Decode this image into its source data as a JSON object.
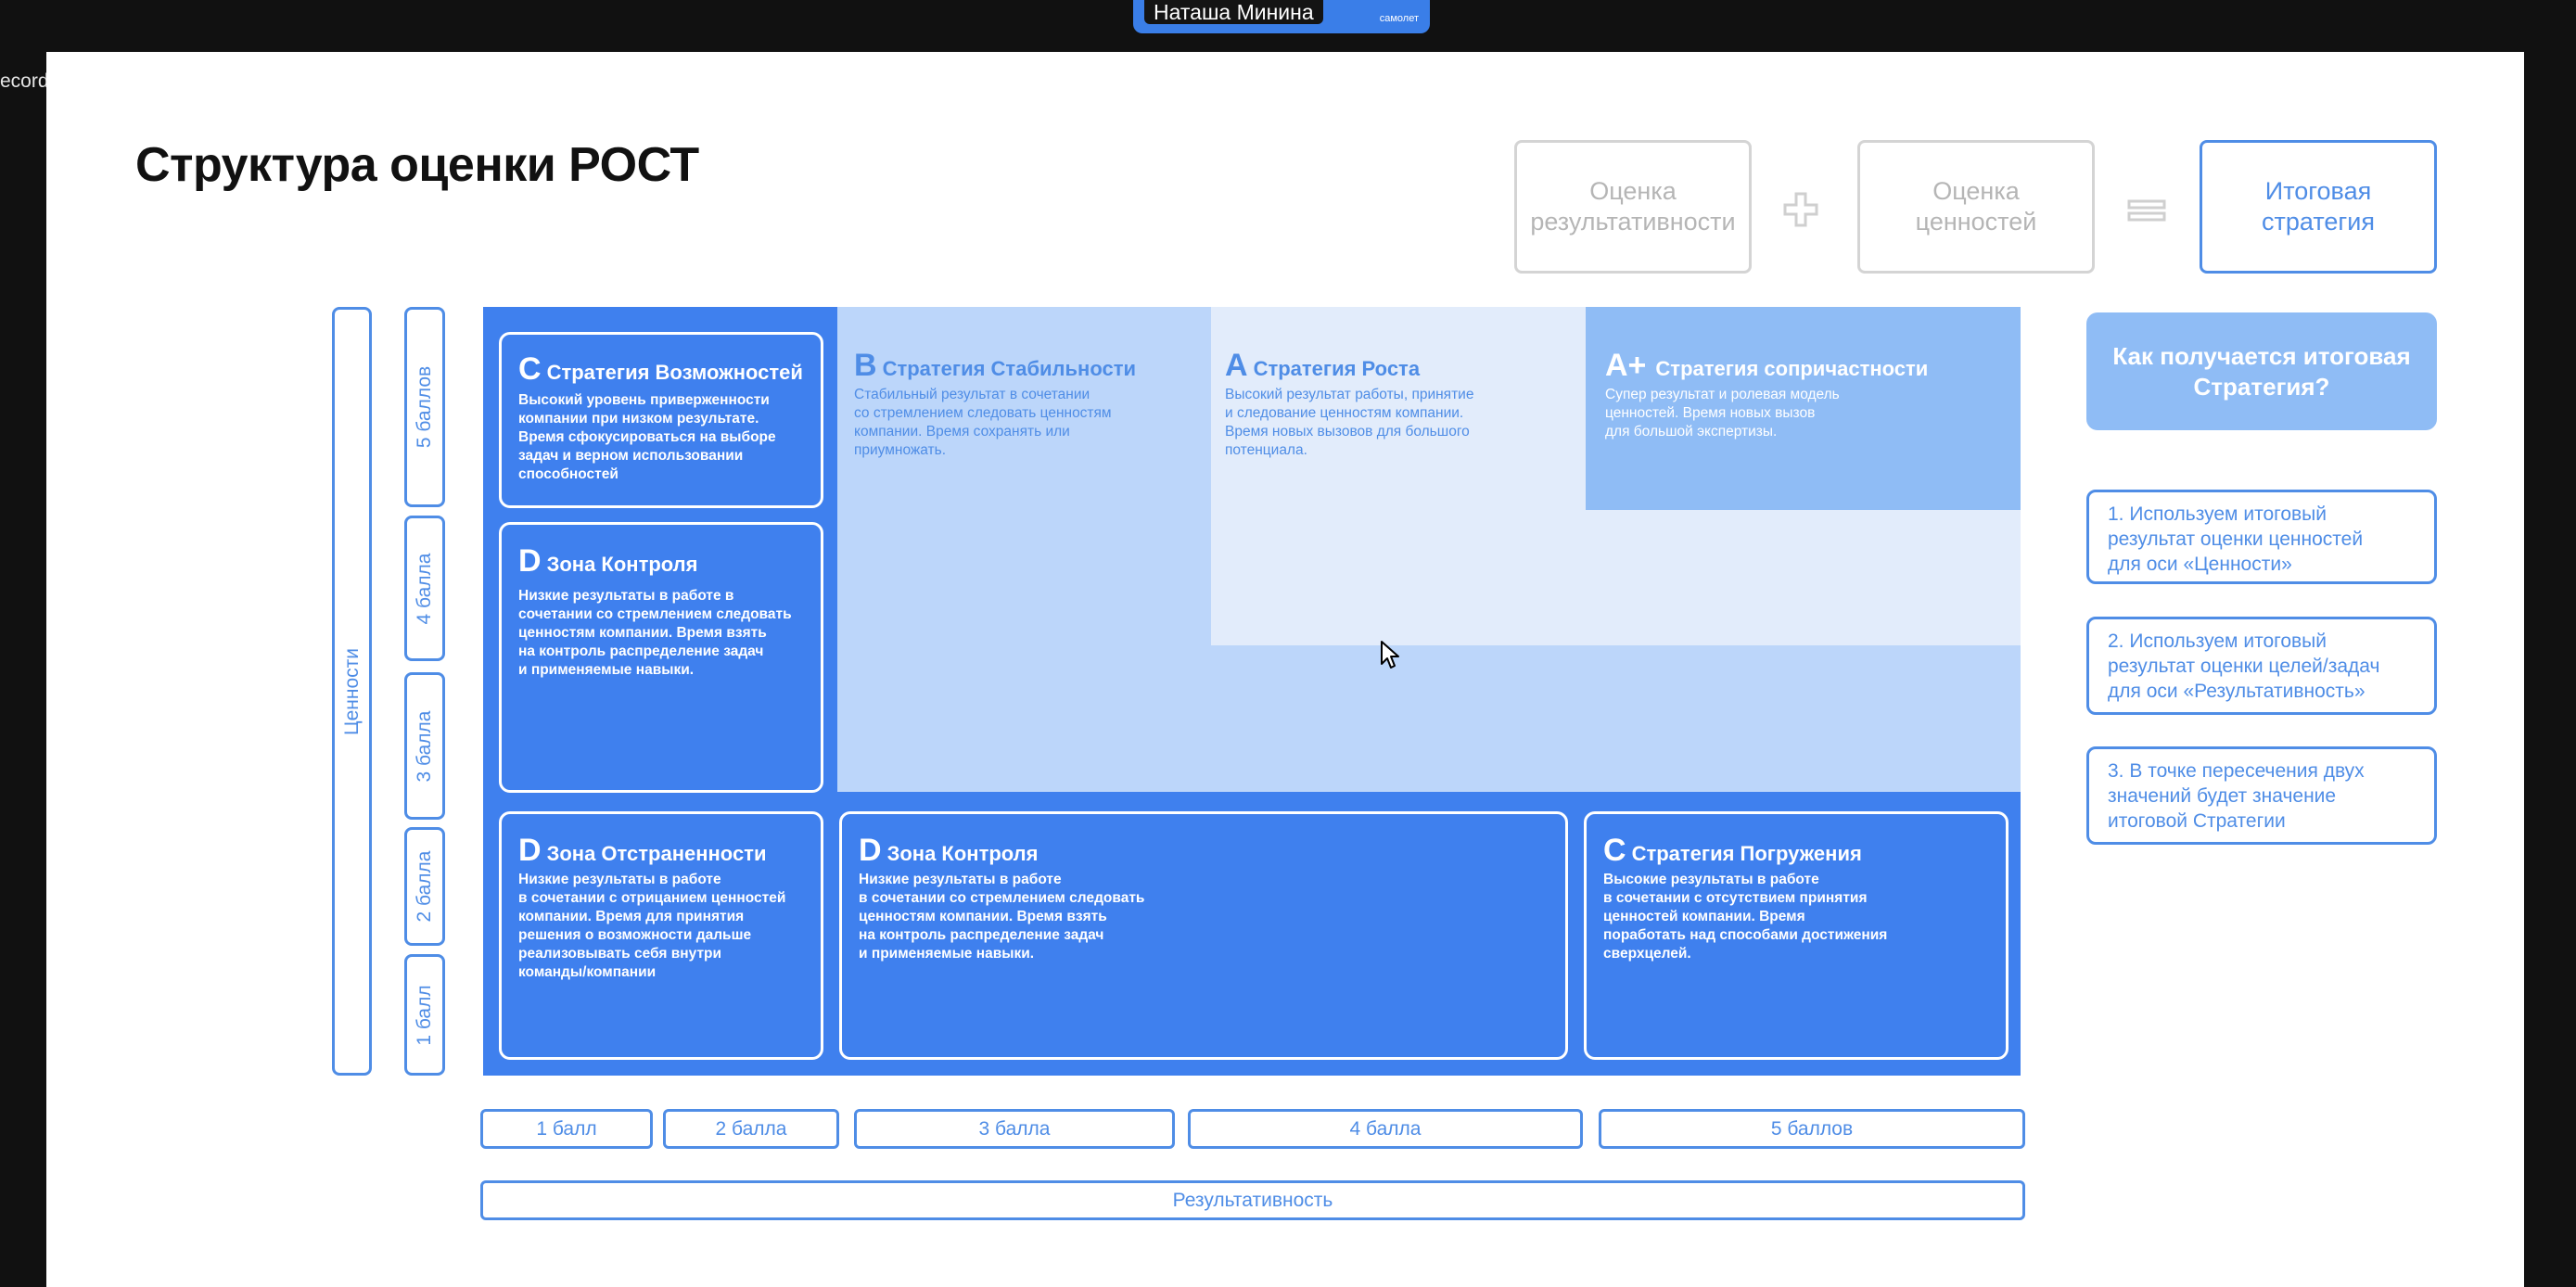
{
  "call": {
    "participant_name": "Наташа Минина",
    "brand_label": "самолет",
    "recording_label": "ecording"
  },
  "slide": {
    "title": "Структура оценки РОСТ",
    "formula": {
      "box1": "Оценка\nрезультативности",
      "box2": "Оценка\nценностей",
      "box3": "Итоговая\nстратегия"
    },
    "y_axis_label": "Ценности",
    "y_ticks": [
      "5 баллов",
      "4 балла",
      "3 балла",
      "2 балла",
      "1 балл"
    ],
    "x_ticks": [
      "1 балл",
      "2 балла",
      "3 балла",
      "4 балла",
      "5 баллов"
    ],
    "x_axis_label": "Результативность",
    "zones": {
      "c_opportunities": {
        "letter": "C",
        "title": "Стратегия Возможностей",
        "desc": "Высокий уровень приверженности\nкомпании при низком результате.\nВремя сфокусироваться на выборе\nзадач и верном использовании\nспособностей"
      },
      "d_control_left": {
        "letter": "D",
        "title": "Зона Контроля",
        "desc": "Низкие результаты в работе в\nсочетании со стремлением следовать\nценностям компании. Время взять\nна контроль распределение задач\nи применяемые навыки."
      },
      "b_stability": {
        "letter": "B",
        "title": "Стратегия Стабильности",
        "desc": "Стабильный результат в сочетании\nсо стремлением следовать ценностям\nкомпании. Время сохранять или\nприумножать."
      },
      "a_growth": {
        "letter": "A",
        "title": "Стратегия Роста",
        "desc": "Высокий результат работы, принятие\nи следование ценностям компании.\nВремя новых вызовов для большого\nпотенциала."
      },
      "a_plus": {
        "letter": "A+",
        "title": "Стратегия сопричастности",
        "desc": "Супер результат и ролевая модель\nценностей. Время новых вызов\nдля большой экспертизы."
      },
      "d_detachment": {
        "letter": "D",
        "title": "Зона Отстраненности",
        "desc": "Низкие результаты в работе\nв сочетании с отрицанием ценностей\nкомпании. Время для принятия\nрешения о возможности дальше\nреализовывать себя внутри\nкоманды/компании"
      },
      "d_control_bottom": {
        "letter": "D",
        "title": "Зона Контроля",
        "desc": "Низкие результаты в работе\nв сочетании со стремлением следовать\nценностям компании. Время взять\nна контроль распределение задач\nи применяемые навыки."
      },
      "c_immersion": {
        "letter": "C",
        "title": "Стратегия Погружения",
        "desc": "Высокие результаты в работе\nв сочетании с отсутствием принятия\nценностей  компании. Время\nпоработать над способами достижения\nсверхцелей."
      }
    },
    "how_title": "Как получается итоговая\nСтратегия?",
    "steps": [
      "1. Используем итоговый\nрезультат оценки ценностей\nдля оси «Ценности»",
      "2. Используем итоговый\nрезультат оценки целей/задач\nдля оси «Результативность»",
      "3. В точке пересечения двух\nзначений будет значение\nитоговой Стратегии"
    ]
  },
  "colors": {
    "primary_blue": "#3f80ee",
    "light_blue": "#bcd6fa",
    "lighter_blue": "#e2ecfb",
    "mid_blue": "#8fbcf5",
    "outline_blue": "#4f8de6"
  }
}
